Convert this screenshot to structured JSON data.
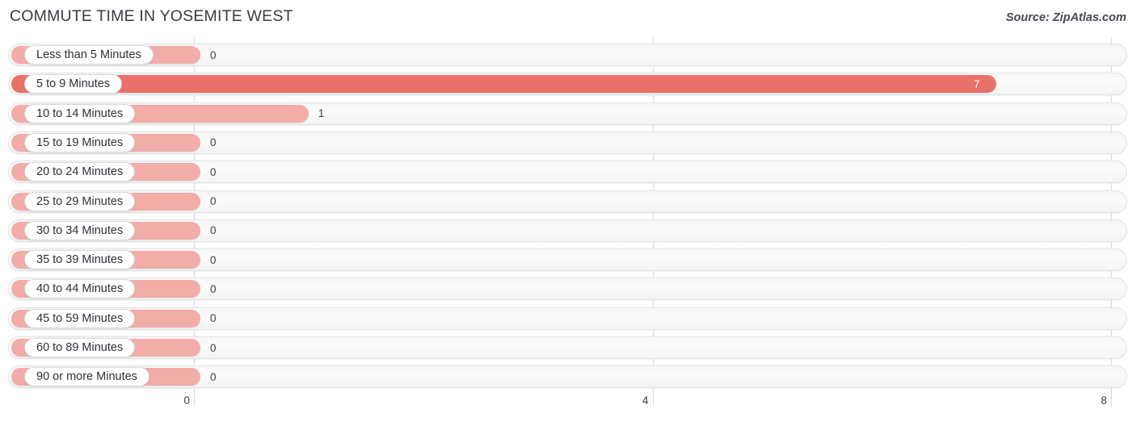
{
  "header": {
    "title": "COMMUTE TIME IN YOSEMITE WEST",
    "source": "Source: ZipAtlas.com"
  },
  "colors": {
    "bar_strong": "#e8716a",
    "bar_light": "#f2ada9",
    "track": "#f7f7f7",
    "gridline": "#d9d9d9",
    "text": "#33333a"
  },
  "chart_data": {
    "type": "bar",
    "orientation": "horizontal",
    "title": "COMMUTE TIME IN YOSEMITE WEST",
    "xlabel": "",
    "ylabel": "",
    "xlim": [
      0,
      8
    ],
    "xticks": [
      "0",
      "4",
      "8"
    ],
    "xtick_values": [
      0,
      4,
      8
    ],
    "grid": true,
    "legend": false,
    "categories": [
      "Less than 5 Minutes",
      "5 to 9 Minutes",
      "10 to 14 Minutes",
      "15 to 19 Minutes",
      "20 to 24 Minutes",
      "25 to 29 Minutes",
      "30 to 34 Minutes",
      "35 to 39 Minutes",
      "40 to 44 Minutes",
      "45 to 59 Minutes",
      "60 to 89 Minutes",
      "90 or more Minutes"
    ],
    "values": [
      0,
      7,
      1,
      0,
      0,
      0,
      0,
      0,
      0,
      0,
      0,
      0
    ],
    "value_labels": [
      "0",
      "7",
      "1",
      "0",
      "0",
      "0",
      "0",
      "0",
      "0",
      "0",
      "0",
      "0"
    ]
  }
}
